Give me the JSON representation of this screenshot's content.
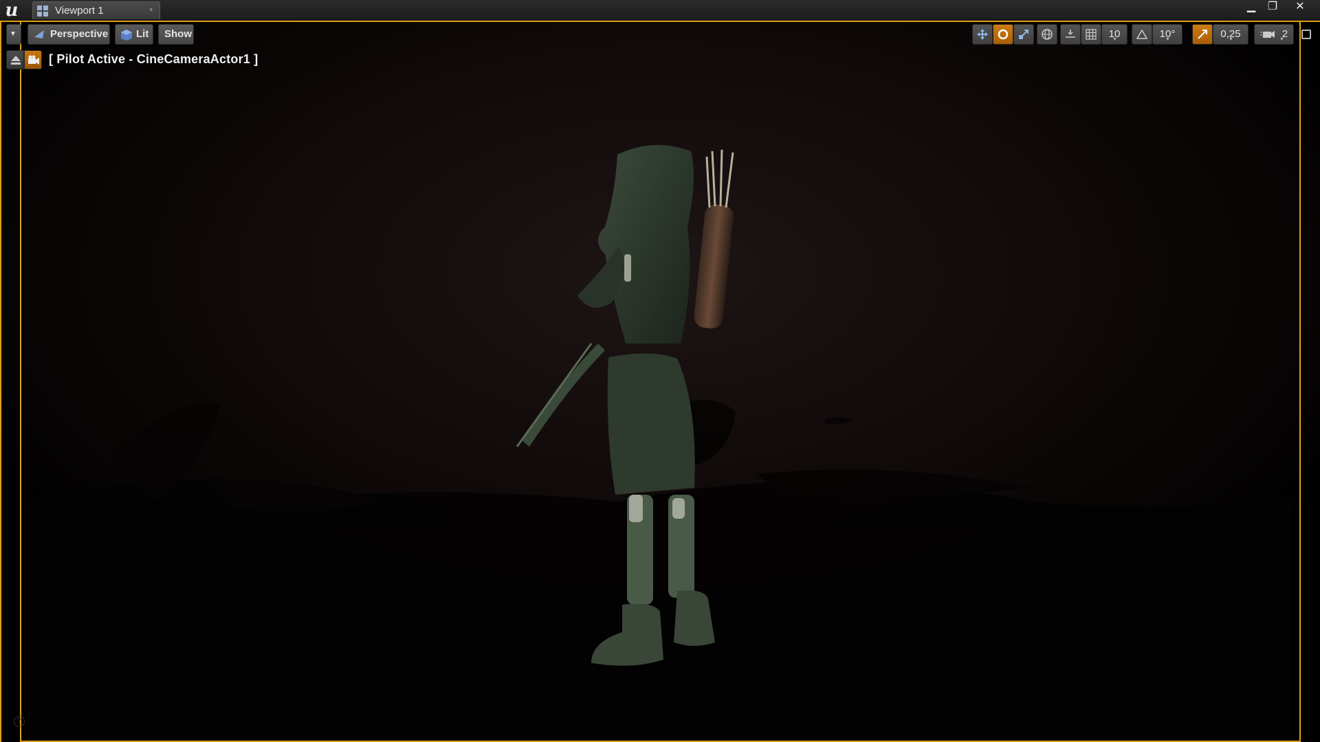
{
  "window": {
    "tab_title": "Viewport 1",
    "controls": {
      "minimize": "▁",
      "restore": "❐",
      "close": "✕"
    }
  },
  "toolbar": {
    "options_icon": "chevron-down-icon",
    "perspective_label": "Perspective",
    "lit_label": "Lit",
    "show_label": "Show",
    "grid_snap_value": "10",
    "rotation_snap_value": "10°",
    "scale_snap_value": "0,25",
    "camera_speed_value": "2"
  },
  "pilot": {
    "status_text": "[ Pilot Active - CineCameraActor1 ]"
  },
  "colors": {
    "accent": "#e0a21a",
    "active_button": "#c7780f",
    "background": "#000000"
  }
}
